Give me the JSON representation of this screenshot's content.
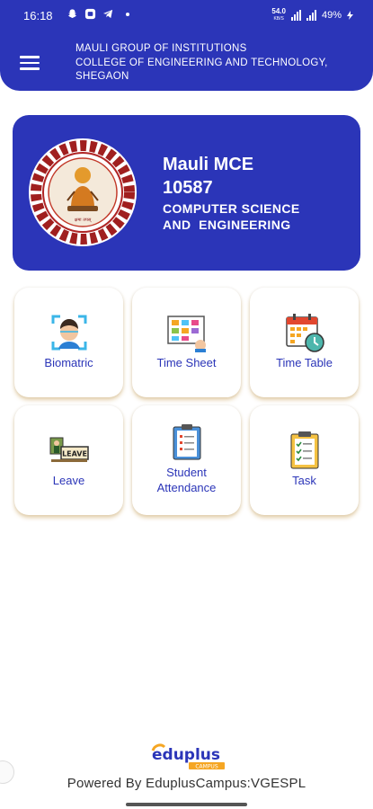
{
  "status_bar": {
    "time": "16:18",
    "net_speed": "54.0",
    "net_unit": "KB/S",
    "battery": "49%"
  },
  "header": {
    "title_line1": "MAULI GROUP OF INSTITUTIONS",
    "title_line2": "COLLEGE OF ENGINEERING AND TECHNOLOGY,",
    "title_line3": "SHEGAON"
  },
  "profile": {
    "name": "Mauli MCE",
    "id": "10587",
    "department": "COMPUTER SCIENCE\nAND  ENGINEERING"
  },
  "tiles": [
    {
      "label": "Biomatric",
      "icon": "face-scan-icon"
    },
    {
      "label": "Time Sheet",
      "icon": "task-board-icon"
    },
    {
      "label": "Time Table",
      "icon": "calendar-clock-icon"
    },
    {
      "label": "Leave",
      "icon": "leave-sign-icon"
    },
    {
      "label_line1": "Student",
      "label_line2": "Attendance",
      "icon": "attendance-clipboard-icon"
    },
    {
      "label": "Task",
      "icon": "task-checklist-icon"
    }
  ],
  "footer": {
    "brand": "eduplus",
    "brand_tag": "CAMPUS",
    "powered_by": "Powered By EduplusCampus:VGESPL"
  },
  "colors": {
    "primary": "#2b35b8",
    "tile_shadow": "#c49646"
  }
}
